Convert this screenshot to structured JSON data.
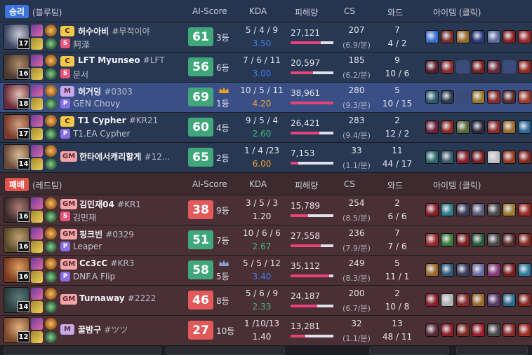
{
  "teams": [
    {
      "result": "승리",
      "side": "(블루팀)",
      "headers": {
        "ai_score": "AI-Score",
        "kda": "KDA",
        "damage": "피해량",
        "cs": "CS",
        "ward": "와드",
        "items": "아이템 (클릭)"
      },
      "players": [
        {
          "level": "17",
          "tier": "C",
          "name": "허수아비",
          "tag": "#무적이야",
          "badge": "S",
          "sub": "阿泽",
          "score": "61",
          "rank": "3등",
          "kda": "5 / 4 / 9",
          "ratio": "3.50",
          "ratio_color": "#3f7cf0",
          "damage": "27,121",
          "dmg_frac": 0.7,
          "cs": "207",
          "cs_min": "(6.9/분)",
          "ward": "7",
          "ward_detail": "4 / 2",
          "champ": [
            "#3b4560",
            "#c9c9d8"
          ],
          "items": [
            "#3a6fd0",
            "#7a2a2a",
            "#9a6a2a",
            "#2a3a7a",
            "#5a6fa0",
            "#8a1f1f",
            "#a02a2a"
          ]
        },
        {
          "level": "16",
          "tier": "C",
          "name": "LFT Myunseo",
          "tag": "#LFT",
          "badge": "S",
          "sub": "문서",
          "score": "56",
          "rank": "6등",
          "kda": "7 / 6 / 11",
          "ratio": "3.00",
          "ratio_color": "#3f7cf0",
          "damage": "20,597",
          "dmg_frac": 0.53,
          "cs": "185",
          "cs_min": "(6.2/분)",
          "ward": "9",
          "ward_detail": "10 / 6",
          "champ": [
            "#4a3a30",
            "#b08a6a"
          ],
          "items": [
            "#5a1f2a",
            "#8a2a2a",
            "empty",
            "#7a1f1f",
            "#6a2a3a",
            "empty",
            "#9a2a1f"
          ]
        },
        {
          "level": "18",
          "tier": "M",
          "name": "허거덩",
          "tag": "#0303",
          "badge": "P",
          "sub": "GEN Chovy",
          "score": "69",
          "rank": "1등",
          "crown": true,
          "me": true,
          "kda": "10 / 5 / 11",
          "ratio": "4.20",
          "ratio_color": "#f0a02a",
          "damage": "38,961",
          "dmg_frac": 1.0,
          "cs": "280",
          "cs_min": "(9.3/분)",
          "ward": "5",
          "ward_detail": "10 / 15",
          "champ": [
            "#6a2a3a",
            "#e0c0b0"
          ],
          "items": [
            "#2a5a6a",
            "#2a3a4a",
            "empty",
            "#9a7a2a",
            "#8a2a2a",
            "#5a2a2a",
            "#a03a2a"
          ]
        },
        {
          "level": "17",
          "tier": "C",
          "name": "T1 Cypher",
          "tag": "#KR21",
          "badge": "P",
          "sub": "T1.EA Cypher",
          "score": "60",
          "rank": "4등",
          "kda": "9 / 5 / 4",
          "ratio": "2.60",
          "ratio_color": "#3fb77a",
          "damage": "26,421",
          "dmg_frac": 0.68,
          "cs": "283",
          "cs_min": "(9.4/분)",
          "ward": "2",
          "ward_detail": "12 / 2",
          "champ": [
            "#7a3a2a",
            "#d0a080"
          ],
          "items": [
            "#6a1f3a",
            "#8a2a1f",
            "#5a6a3a",
            "#2a2a3a",
            "#8a2a2a",
            "#9a6a2a",
            "#2a6a9a"
          ]
        },
        {
          "level": "14",
          "tier": "GM",
          "name": "한타에서캐리할게",
          "tag": "#12...",
          "badge": "",
          "sub": "",
          "score": "65",
          "rank": "2등",
          "kda": "1 / 4 /23",
          "ratio": "6.00",
          "ratio_color": "#f0a02a",
          "damage": "7,153",
          "dmg_frac": 0.18,
          "cs": "33",
          "cs_min": "(1.1/분)",
          "ward": "11",
          "ward_detail": "44 / 17",
          "champ": [
            "#6a4a3a",
            "#d8b890"
          ],
          "items": [
            "#2a6a6a",
            "#3a5a6a",
            "#8a1f2a",
            "#7a1f1f",
            "#c0c0c0",
            "#9a3a1f",
            "#8a2a1f"
          ]
        }
      ]
    },
    {
      "result": "패배",
      "side": "(레드팀)",
      "headers": {
        "ai_score": "AI-Score",
        "kda": "KDA",
        "damage": "피해량",
        "cs": "CS",
        "ward": "와드",
        "items": "아이템 (클릭)"
      },
      "players": [
        {
          "level": "16",
          "tier": "GM",
          "name": "김민재04",
          "tag": "#KR1",
          "badge": "S",
          "sub": "김민재",
          "score": "38",
          "rank": "9등",
          "kda": "3 / 5 / 3",
          "ratio": "1.20",
          "ratio_color": "#e3e4ea",
          "damage": "15,789",
          "dmg_frac": 0.41,
          "cs": "254",
          "cs_min": "(8.5/분)",
          "ward": "2",
          "ward_detail": "6 / 6",
          "champ": [
            "#3a2a30",
            "#b07a70"
          ],
          "items": [
            "#8a1f2a",
            "#2a7a8a",
            "#3a3a5a",
            "#5a5a7a",
            "#4a4a4a",
            "#9a7a2a",
            "#a02a1f"
          ]
        },
        {
          "level": "16",
          "tier": "GM",
          "name": "핑크빈",
          "tag": "#0329",
          "badge": "P",
          "sub": "Leaper",
          "score": "51",
          "rank": "7등",
          "kda": "10 / 6 / 6",
          "ratio": "2.67",
          "ratio_color": "#3fb77a",
          "damage": "27,558",
          "dmg_frac": 0.71,
          "cs": "236",
          "cs_min": "(7.9/분)",
          "ward": "7",
          "ward_detail": "7 / 6",
          "champ": [
            "#5a4a2a",
            "#c0a070"
          ],
          "items": [
            "#9a2a2a",
            "#3a7a3a",
            "#7a1f1f",
            "#2a5a3a",
            "#4a4a4a",
            "#5a2a2a",
            "#8a2a1f"
          ]
        },
        {
          "level": "16",
          "tier": "GM",
          "name": "Cc3cC",
          "tag": "#KR3",
          "badge": "P",
          "sub": "DNF.A Flip",
          "score": "58",
          "rank": "5등",
          "crown_outline": true,
          "kda": "5 / 5 / 12",
          "ratio": "3.40",
          "ratio_color": "#3f7cf0",
          "damage": "35,112",
          "dmg_frac": 0.9,
          "cs": "249",
          "cs_min": "(8.3/분)",
          "ward": "5",
          "ward_detail": "11 / 1",
          "champ": [
            "#7a3a1f",
            "#e0a060"
          ],
          "items": [
            "#9a6a2a",
            "#2a5a7a",
            "#3a3a5a",
            "#6a6aa0",
            "#8a3a7a",
            "#7a1f1f",
            "#2a7aa0"
          ]
        },
        {
          "level": "14",
          "tier": "GM",
          "name": "Turnaway",
          "tag": "#2222",
          "badge": "",
          "sub": "",
          "score": "46",
          "rank": "8등",
          "kda": "5 / 6 / 9",
          "ratio": "2.33",
          "ratio_color": "#3fb77a",
          "damage": "24,187",
          "dmg_frac": 0.62,
          "cs": "200",
          "cs_min": "(6.7/분)",
          "ward": "2",
          "ward_detail": "10 / 8",
          "champ": [
            "#2a3a3a",
            "#5a7a7a"
          ],
          "items": [
            "#8a1f2a",
            "#b0b0b0",
            "#8a2a2a",
            "#9a6a2a",
            "#5a3a6a",
            "#2a6a8a",
            "#8a2a1f"
          ]
        },
        {
          "level": "12",
          "tier": "M",
          "name": "꿀밤구",
          "tag": "#ツツ",
          "badge": "",
          "sub": "",
          "score": "27",
          "rank": "10등",
          "kda": "1 /10/13",
          "ratio": "1.40",
          "ratio_color": "#e3e4ea",
          "damage": "13,281",
          "dmg_frac": 0.34,
          "cs": "32",
          "cs_min": "(1.1/분)",
          "ward": "13",
          "ward_detail": "48 / 11",
          "champ": [
            "#7a4a2a",
            "#e0b080"
          ],
          "items": [
            "#5a2a3a",
            "#8a1f2a",
            "#7a2a1f",
            "#9a1f2a",
            "#4a4a4a",
            "#8a2a2a",
            "#a02a1f"
          ]
        }
      ]
    }
  ],
  "colors": {
    "score_high": "#3fa77a",
    "score_low": "#e05a5a",
    "tier_C": "#f4c84a",
    "tier_M": "#c9a8e8",
    "tier_GM": "#f2a5a5",
    "badge_S": "#e8547a",
    "badge_P": "#8a6ee8"
  }
}
